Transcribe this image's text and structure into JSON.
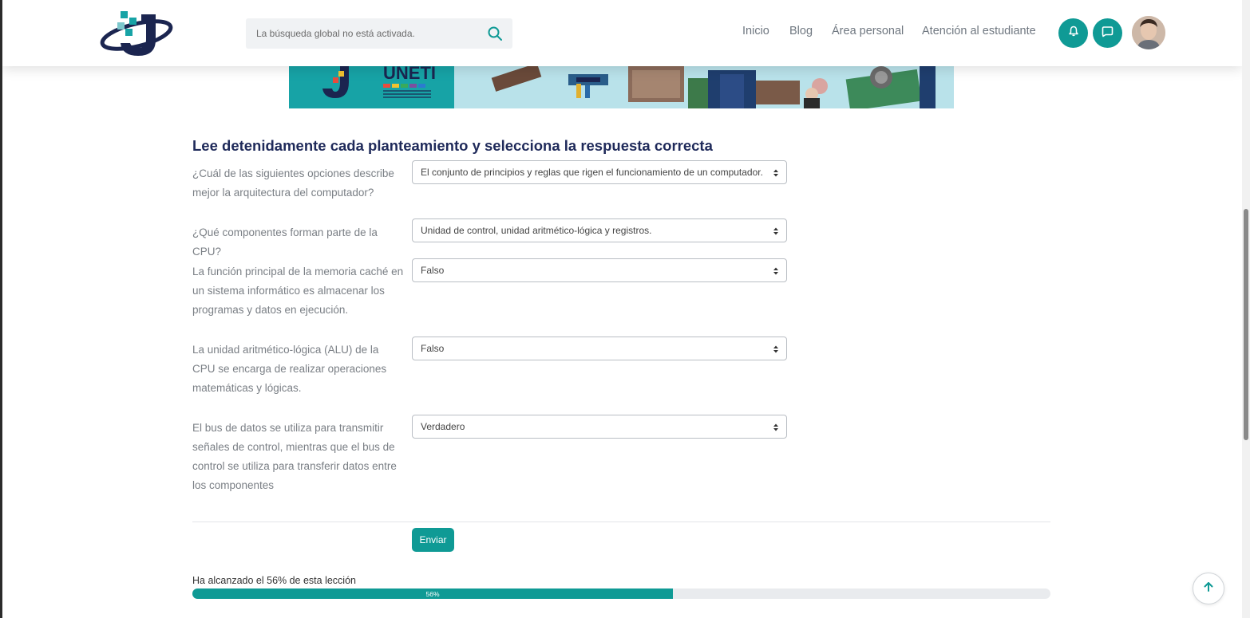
{
  "header": {
    "search_placeholder": "La búsqueda global no está activada.",
    "nav": [
      "Inicio",
      "Blog",
      "Área personal",
      "Atención al estudiante"
    ],
    "icons": {
      "search": "search-icon",
      "notifications": "bell-icon",
      "messages": "chat-icon"
    },
    "accent_color": "#0f9a95"
  },
  "banner": {
    "text": "UNETI"
  },
  "quiz": {
    "title": "Lee detenidamente cada planteamiento y selecciona la respuesta correcta",
    "questions": [
      {
        "text": "¿Cuál de las siguientes opciones describe mejor la arquitectura del computador?",
        "selected": "El conjunto de principios y reglas que rigen el funcionamiento de un computador."
      },
      {
        "text": "¿Qué componentes forman parte de la CPU?",
        "selected": "Unidad de control, unidad aritmético-lógica y registros."
      },
      {
        "text": "La función principal de la memoria caché en un sistema informático es almacenar los programas y datos en ejecución.",
        "selected": "Falso"
      },
      {
        "text": "La unidad aritmético-lógica (ALU) de la CPU se encarga de realizar operaciones matemáticas y lógicas.",
        "selected": "Falso"
      },
      {
        "text": "El bus de datos se utiliza para transmitir señales de control, mientras que el bus de control se utiliza para transferir datos entre los componentes",
        "selected": "Verdadero"
      }
    ],
    "submit_label": "Enviar"
  },
  "progress": {
    "label": "Ha alcanzado el 56% de esta lección",
    "percent": 56,
    "percent_text": "56%"
  }
}
